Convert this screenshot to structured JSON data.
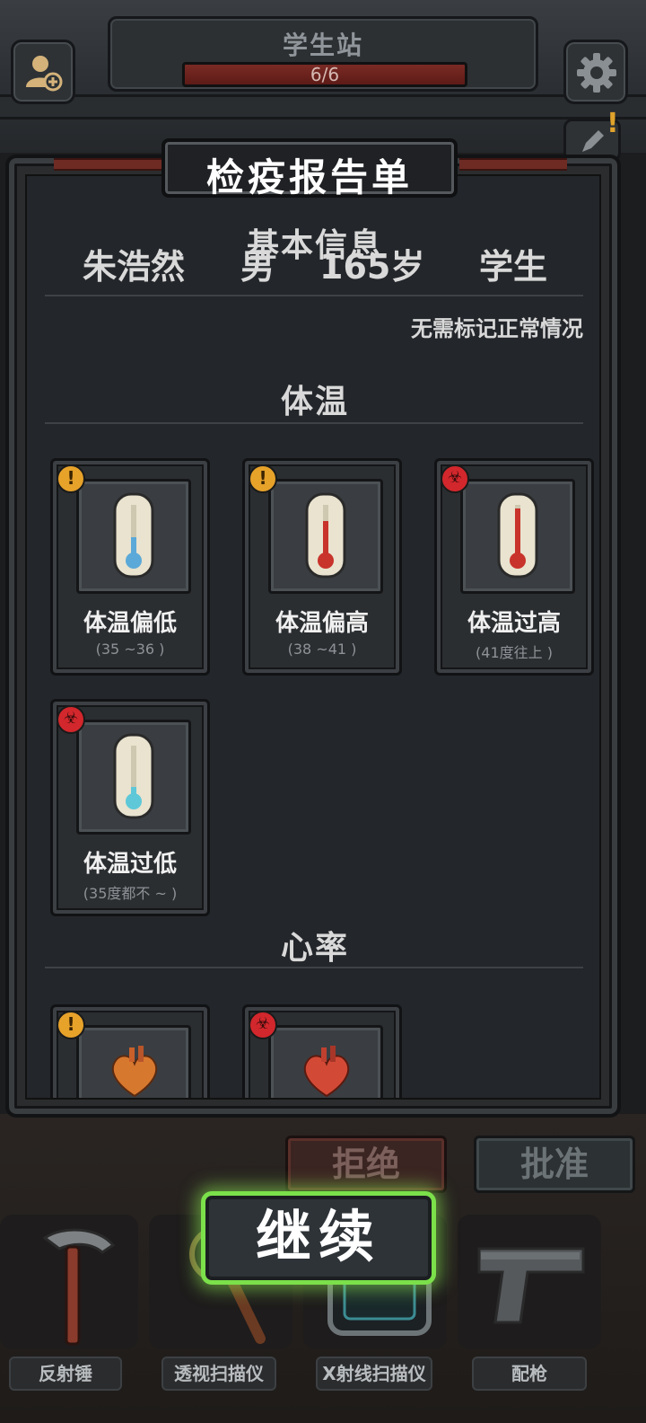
{
  "header": {
    "station_name": "学生站",
    "progress_text": "6/6",
    "progress_fraction": 1.0
  },
  "report": {
    "title": "检疫报告单",
    "basic_info_heading": "基本信息",
    "person": {
      "name": "朱浩然",
      "gender": "男",
      "age": "165岁",
      "occupation": "学生"
    },
    "note": "无需标记正常情况",
    "temperature_section": {
      "heading": "体温",
      "cards": [
        {
          "label": "体温偏低",
          "range": "(35 ~36 )",
          "severity": "warning",
          "thermo_color": "#5ba9d8"
        },
        {
          "label": "体温偏高",
          "range": "(38 ~41 )",
          "severity": "warning",
          "thermo_color": "#c8332b"
        },
        {
          "label": "体温过高",
          "range": "(41度往上 )",
          "severity": "danger",
          "thermo_color": "#c8332b"
        },
        {
          "label": "体温过低",
          "range": "(35度都不 ~ )",
          "severity": "danger",
          "thermo_color": "#5ec8d8"
        }
      ]
    },
    "heart_section": {
      "heading": "心率",
      "cards": [
        {
          "severity": "warning",
          "heart_color": "#d7782f"
        },
        {
          "severity": "danger",
          "heart_color": "#d24a36"
        }
      ]
    }
  },
  "actions": {
    "reject_label": "拒绝",
    "approve_label": "批准",
    "continue_label": "继续"
  },
  "tools": [
    {
      "label": "反射锤",
      "icon": "hammer-icon"
    },
    {
      "label": "透视扫描仪",
      "icon": "magnifier-icon"
    },
    {
      "label": "X射线扫描仪",
      "icon": "xray-scanner-icon"
    },
    {
      "label": "配枪",
      "icon": "pistol-icon"
    }
  ],
  "badges": {
    "warning_glyph": "!",
    "danger_glyph": "☣"
  }
}
